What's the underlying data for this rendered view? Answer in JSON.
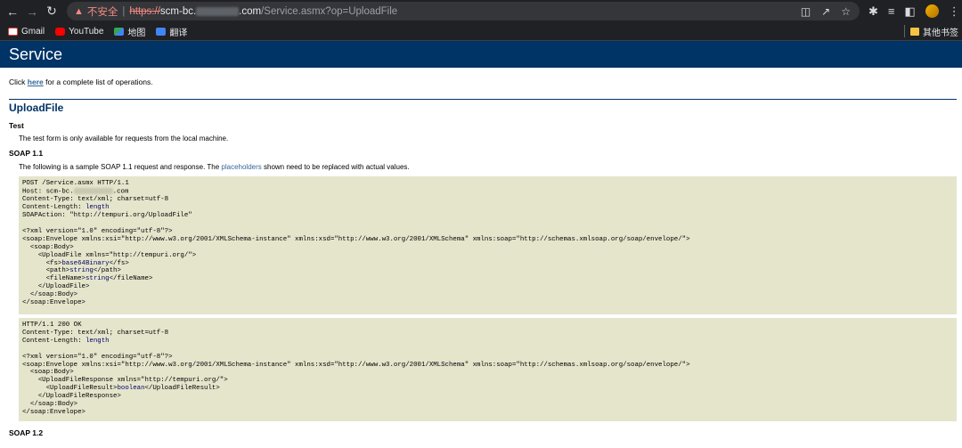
{
  "browser": {
    "not_secure": "不安全",
    "separator": "|",
    "url_protocol": "https://",
    "url_host_start": "scm-bc.",
    "url_host_end": ".com",
    "url_path": "/Service.asmx?op=UploadFile",
    "bookmarks": [
      {
        "label": "Gmail",
        "icon": "gmail-icon"
      },
      {
        "label": "YouTube",
        "icon": "youtube-icon"
      },
      {
        "label": "地图",
        "icon": "maps-icon"
      },
      {
        "label": "翻译",
        "icon": "translate-icon"
      }
    ],
    "other_bookmarks": "其他书签"
  },
  "page": {
    "title": "Service",
    "intro_prefix": "Click ",
    "intro_link": "here",
    "intro_suffix": " for a complete list of operations.",
    "operation": "UploadFile",
    "test_heading": "Test",
    "test_text": "The test form is only available for requests from the local machine.",
    "soap11_heading": "SOAP 1.1",
    "soap11_text_prefix": "The following is a sample SOAP 1.1 request and response. The ",
    "soap11_text_link": "placeholders",
    "soap11_text_suffix": " shown need to be replaced with actual values.",
    "soap12_heading": "SOAP 1.2"
  },
  "request": {
    "l1": "POST /Service.asmx HTTP/1.1",
    "l2": "Host: scm-bc.",
    "l2b": ".com",
    "l3": "Content-Type: text/xml; charset=utf-8",
    "l4": "Content-Length: ",
    "l4v": "length",
    "l5": "SOAPAction: \"http://tempuri.org/UploadFile\"",
    "l6": "<?xml version=\"1.0\" encoding=\"utf-8\"?>",
    "l7": "<soap:Envelope xmlns:xsi=\"http://www.w3.org/2001/XMLSchema-instance\" xmlns:xsd=\"http://www.w3.org/2001/XMLSchema\" xmlns:soap=\"http://schemas.xmlsoap.org/soap/envelope/\">",
    "l8": "  <soap:Body>",
    "l9": "    <UploadFile xmlns=\"http://tempuri.org/\">",
    "l10a": "      <fs>",
    "l10v": "base64Binary",
    "l10b": "</fs>",
    "l11a": "      <path>",
    "l11v": "string",
    "l11b": "</path>",
    "l12a": "      <fileName>",
    "l12v": "string",
    "l12b": "</fileName>",
    "l13": "    </UploadFile>",
    "l14": "  </soap:Body>",
    "l15": "</soap:Envelope>"
  },
  "response": {
    "l1": "HTTP/1.1 200 OK",
    "l2": "Content-Type: text/xml; charset=utf-8",
    "l3": "Content-Length: ",
    "l3v": "length",
    "l4": "<?xml version=\"1.0\" encoding=\"utf-8\"?>",
    "l5": "<soap:Envelope xmlns:xsi=\"http://www.w3.org/2001/XMLSchema-instance\" xmlns:xsd=\"http://www.w3.org/2001/XMLSchema\" xmlns:soap=\"http://schemas.xmlsoap.org/soap/envelope/\">",
    "l6": "  <soap:Body>",
    "l7": "    <UploadFileResponse xmlns=\"http://tempuri.org/\">",
    "l8a": "      <UploadFileResult>",
    "l8v": "boolean",
    "l8b": "</UploadFileResult>",
    "l9": "    </UploadFileResponse>",
    "l10": "  </soap:Body>",
    "l11": "</soap:Envelope>"
  },
  "colors": {
    "header_bg": "#003366",
    "code_bg": "#e5e5cc",
    "link": "#336699",
    "chrome_bg": "#202124"
  }
}
